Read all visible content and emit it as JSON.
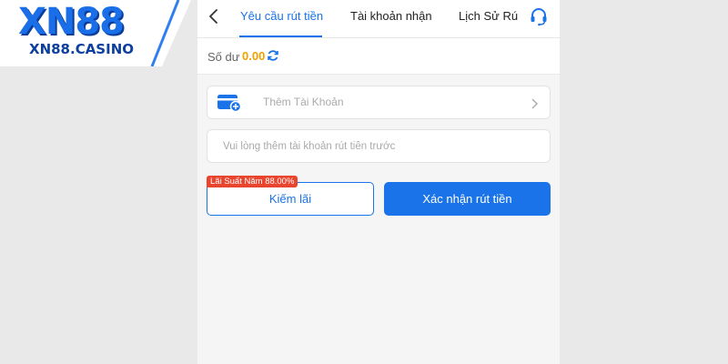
{
  "logo": {
    "main": "XN88",
    "sub": "XN88.CASINO"
  },
  "header": {
    "tabs": [
      {
        "label": "Yêu cầu rút tiền",
        "active": true
      },
      {
        "label": "Tài khoản nhận",
        "active": false
      },
      {
        "label": "Lịch Sử Rú",
        "active": false
      }
    ],
    "back_icon": "chevron-left-icon",
    "support_icon": "headset-icon"
  },
  "balance": {
    "label": "Số dư",
    "value": "0.00",
    "refresh_icon": "refresh-icon"
  },
  "add_account": {
    "label": "Thêm Tài Khoản",
    "icon": "wallet-add-icon"
  },
  "notice": {
    "placeholder": "Vui lòng thêm tài khoản rút tiền trước"
  },
  "actions": {
    "promo_badge": "Lãi Suất Năm 88.00%",
    "earn_label": "Kiếm lãi",
    "confirm_label": "Xác nhận rút tiền"
  },
  "colors": {
    "accent": "#1a73e8",
    "balance": "#f0a000",
    "badge": "#e8442e"
  }
}
